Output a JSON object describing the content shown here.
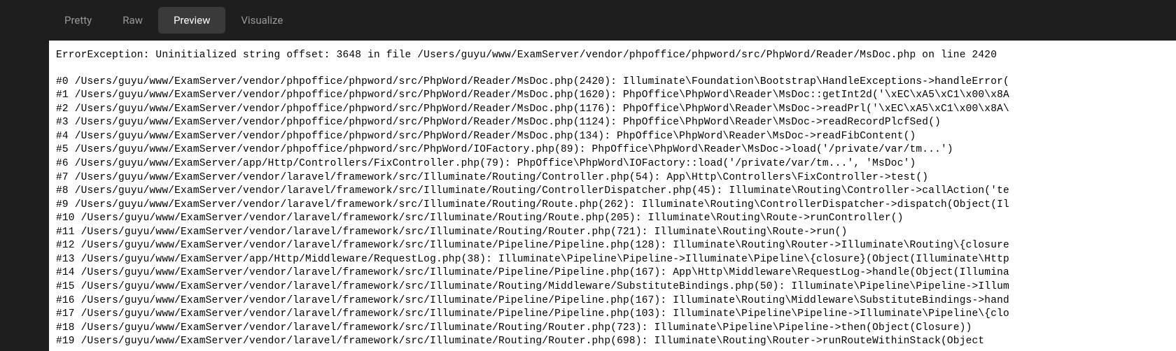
{
  "tabs": {
    "pretty": "Pretty",
    "raw": "Raw",
    "preview": "Preview",
    "visualize": "Visualize"
  },
  "error_message": "ErrorException: Uninitialized string offset: 3648 in file /Users/guyu/www/ExamServer/vendor/phpoffice/phpword/src/PhpWord/Reader/MsDoc.php on line 2420",
  "stack": [
    "#0 /Users/guyu/www/ExamServer/vendor/phpoffice/phpword/src/PhpWord/Reader/MsDoc.php(2420): Illuminate\\Foundation\\Bootstrap\\HandleExceptions->handleError(",
    "#1 /Users/guyu/www/ExamServer/vendor/phpoffice/phpword/src/PhpWord/Reader/MsDoc.php(1620): PhpOffice\\PhpWord\\Reader\\MsDoc::getInt2d('\\xEC\\xA5\\xC1\\x00\\x8A",
    "#2 /Users/guyu/www/ExamServer/vendor/phpoffice/phpword/src/PhpWord/Reader/MsDoc.php(1176): PhpOffice\\PhpWord\\Reader\\MsDoc->readPrl('\\xEC\\xA5\\xC1\\x00\\x8A\\",
    "#3 /Users/guyu/www/ExamServer/vendor/phpoffice/phpword/src/PhpWord/Reader/MsDoc.php(1124): PhpOffice\\PhpWord\\Reader\\MsDoc->readRecordPlcfSed()",
    "#4 /Users/guyu/www/ExamServer/vendor/phpoffice/phpword/src/PhpWord/Reader/MsDoc.php(134): PhpOffice\\PhpWord\\Reader\\MsDoc->readFibContent()",
    "#5 /Users/guyu/www/ExamServer/vendor/phpoffice/phpword/src/PhpWord/IOFactory.php(89): PhpOffice\\PhpWord\\Reader\\MsDoc->load('/private/var/tm...')",
    "#6 /Users/guyu/www/ExamServer/app/Http/Controllers/FixController.php(79): PhpOffice\\PhpWord\\IOFactory::load('/private/var/tm...', 'MsDoc')",
    "#7 /Users/guyu/www/ExamServer/vendor/laravel/framework/src/Illuminate/Routing/Controller.php(54): App\\Http\\Controllers\\FixController->test()",
    "#8 /Users/guyu/www/ExamServer/vendor/laravel/framework/src/Illuminate/Routing/ControllerDispatcher.php(45): Illuminate\\Routing\\Controller->callAction('te",
    "#9 /Users/guyu/www/ExamServer/vendor/laravel/framework/src/Illuminate/Routing/Route.php(262): Illuminate\\Routing\\ControllerDispatcher->dispatch(Object(Il",
    "#10 /Users/guyu/www/ExamServer/vendor/laravel/framework/src/Illuminate/Routing/Route.php(205): Illuminate\\Routing\\Route->runController()",
    "#11 /Users/guyu/www/ExamServer/vendor/laravel/framework/src/Illuminate/Routing/Router.php(721): Illuminate\\Routing\\Route->run()",
    "#12 /Users/guyu/www/ExamServer/vendor/laravel/framework/src/Illuminate/Pipeline/Pipeline.php(128): Illuminate\\Routing\\Router->Illuminate\\Routing\\{closure",
    "#13 /Users/guyu/www/ExamServer/app/Http/Middleware/RequestLog.php(38): Illuminate\\Pipeline\\Pipeline->Illuminate\\Pipeline\\{closure}(Object(Illuminate\\Http",
    "#14 /Users/guyu/www/ExamServer/vendor/laravel/framework/src/Illuminate/Pipeline/Pipeline.php(167): App\\Http\\Middleware\\RequestLog->handle(Object(Illumina",
    "#15 /Users/guyu/www/ExamServer/vendor/laravel/framework/src/Illuminate/Routing/Middleware/SubstituteBindings.php(50): Illuminate\\Pipeline\\Pipeline->Illum",
    "#16 /Users/guyu/www/ExamServer/vendor/laravel/framework/src/Illuminate/Pipeline/Pipeline.php(167): Illuminate\\Routing\\Middleware\\SubstituteBindings->hand",
    "#17 /Users/guyu/www/ExamServer/vendor/laravel/framework/src/Illuminate/Pipeline/Pipeline.php(103): Illuminate\\Pipeline\\Pipeline->Illuminate\\Pipeline\\{clo",
    "#18 /Users/guyu/www/ExamServer/vendor/laravel/framework/src/Illuminate/Routing/Router.php(723): Illuminate\\Pipeline\\Pipeline->then(Object(Closure))",
    "#19 /Users/guyu/www/ExamServer/vendor/laravel/framework/src/Illuminate/Routing/Router.php(698): Illuminate\\Routing\\Router->runRouteWithinStack(Object"
  ]
}
